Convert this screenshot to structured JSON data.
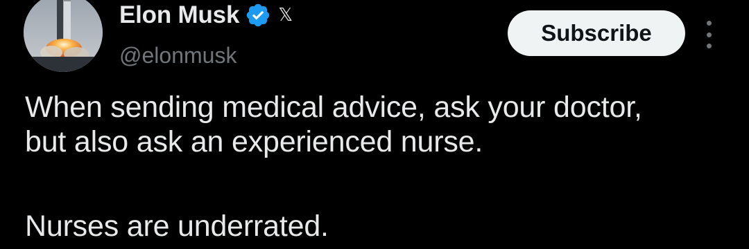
{
  "author": {
    "display_name": "Elon Musk",
    "handle": "@elonmusk",
    "verified_icon": "verified-badge-icon",
    "affiliation_icon": "x-logo-icon",
    "affiliation_glyph": "𝕏"
  },
  "actions": {
    "subscribe_label": "Subscribe",
    "more_icon": "more-options-icon"
  },
  "tweet": {
    "line1": "When sending medical advice, ask your doctor,",
    "line2": "but also ask an experienced nurse.",
    "line3": "Nurses are underrated."
  },
  "colors": {
    "background": "#000000",
    "text": "#e7e9ea",
    "secondary_text": "#71767b",
    "verified_blue": "#1d9bf0",
    "subscribe_bg": "#eff3f4"
  }
}
